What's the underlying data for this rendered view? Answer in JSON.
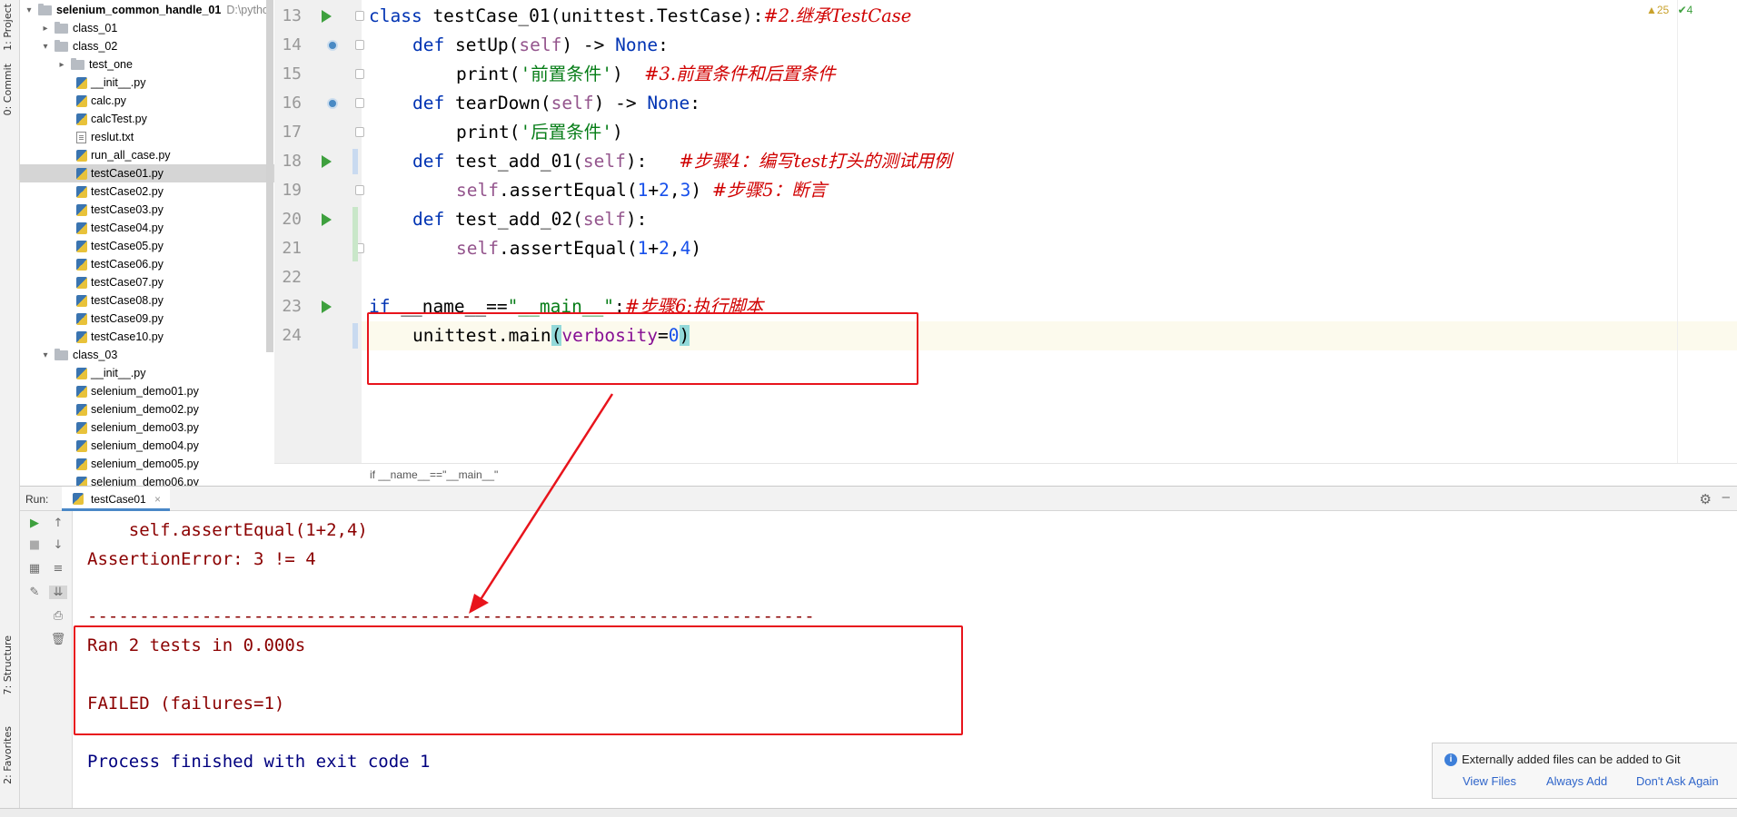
{
  "sidebar": {
    "tab_project": "1: Project",
    "tab_commit": "0: Commit",
    "tab_structure": "7: Structure",
    "tab_favorites": "2: Favorites"
  },
  "tree": {
    "root_label": "selenium_common_handle_01",
    "root_path": "D:\\pytho",
    "items": [
      {
        "label": "class_01"
      },
      {
        "label": "class_02"
      },
      {
        "label": "test_one"
      },
      {
        "label": "__init__.py"
      },
      {
        "label": "calc.py"
      },
      {
        "label": "calcTest.py"
      },
      {
        "label": "reslut.txt"
      },
      {
        "label": "run_all_case.py"
      },
      {
        "label": "testCase01.py"
      },
      {
        "label": "testCase02.py"
      },
      {
        "label": "testCase03.py"
      },
      {
        "label": "testCase04.py"
      },
      {
        "label": "testCase05.py"
      },
      {
        "label": "testCase06.py"
      },
      {
        "label": "testCase07.py"
      },
      {
        "label": "testCase08.py"
      },
      {
        "label": "testCase09.py"
      },
      {
        "label": "testCase10.py"
      },
      {
        "label": "class_03"
      },
      {
        "label": "__init__.py"
      },
      {
        "label": "selenium_demo01.py"
      },
      {
        "label": "selenium_demo02.py"
      },
      {
        "label": "selenium_demo03.py"
      },
      {
        "label": "selenium_demo04.py"
      },
      {
        "label": "selenium_demo05.py"
      },
      {
        "label": "selenium_demo06.py"
      }
    ]
  },
  "editor": {
    "line_numbers": [
      "13",
      "14",
      "15",
      "16",
      "17",
      "18",
      "19",
      "20",
      "21",
      "22",
      "23",
      "24"
    ],
    "code": {
      "l13_kw": "class",
      "l13_name": " testCase_01(unittest.TestCase):",
      "l13_cm": "#2.继承TestCase",
      "l14_kw": "def",
      "l14_a": " setUp(",
      "l14_self": "self",
      "l14_b": ") -> ",
      "l14_none": "None",
      "l14_c": ":",
      "l15_a": "print(",
      "l15_str": "'前置条件'",
      "l15_b": ")  ",
      "l15_cm": "#3.前置条件和后置条件",
      "l16_kw": "def",
      "l16_a": " tearDown(",
      "l16_self": "self",
      "l16_b": ") -> ",
      "l16_none": "None",
      "l16_c": ":",
      "l17_a": "print(",
      "l17_str": "'后置条件'",
      "l17_b": ")",
      "l18_kw": "def",
      "l18_a": " test_add_01(",
      "l18_self": "self",
      "l18_b": "):   ",
      "l18_cm": "#步骤4：编写test打头的测试用例",
      "l19_self": "self",
      "l19_a": ".assertEqual(",
      "l19_n1": "1",
      "l19_plus": "+",
      "l19_n2": "2",
      "l19_comma": ",",
      "l19_n3": "3",
      "l19_b": ") ",
      "l19_cm": "#步骤5：断言",
      "l20_kw": "def",
      "l20_a": " test_add_02(",
      "l20_self": "self",
      "l20_b": "):",
      "l21_self": "self",
      "l21_a": ".assertEqual(",
      "l21_n1": "1",
      "l21_plus": "+",
      "l21_n2": "2",
      "l21_comma": ",",
      "l21_n3": "4",
      "l21_b": ")",
      "l23_kw": "if",
      "l23_a": " __name__==",
      "l23_str": "\"__main__\"",
      "l23_b": ":",
      "l23_cm": "#步骤6:执行脚本",
      "l24_a": "unittest.main",
      "l24_p1": "(",
      "l24_param": "verbosity",
      "l24_eq": "=",
      "l24_num": "0",
      "l24_p2": ")"
    },
    "breadcrumb": "if __name__==\"__main__\"",
    "warnings": "▲25",
    "checks": "✔4"
  },
  "run": {
    "label": "Run:",
    "tab": "testCase01",
    "tab_close": "×",
    "output": {
      "line1": "    self.assertEqual(1+2,4)",
      "line2": "AssertionError: 3 != 4",
      "line3": "----------------------------------------------------------------------",
      "line4": "Ran 2 tests in 0.000s",
      "line5": "FAILED (failures=1)",
      "line6": "Process finished with exit code 1"
    }
  },
  "notification": {
    "title": "Externally added files can be added to Git",
    "link_view": "View Files",
    "link_always": "Always Add",
    "link_dont": "Don't Ask Again"
  },
  "colors": {
    "annotation_red": "#e8141c",
    "run_green": "#3ea03e"
  }
}
